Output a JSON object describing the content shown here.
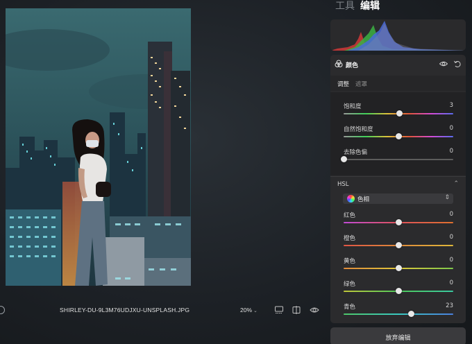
{
  "tabs": [
    {
      "label": "工具",
      "active": false
    },
    {
      "label": "编辑",
      "active": true
    }
  ],
  "photo": {
    "description_icon": "city-night-portrait"
  },
  "bottom_bar": {
    "filename": "SHIRLEY-DU-9L3M76UDJXU-UNSPLASH.JPG",
    "zoom": "20%",
    "icons": [
      "info-icon",
      "filmstrip-icon",
      "compare-icon",
      "eye-icon"
    ]
  },
  "color_panel": {
    "title": "颜色",
    "subtabs": [
      {
        "label": "调整",
        "active": true
      },
      {
        "label": "遮罩",
        "active": false
      }
    ],
    "sliders": [
      {
        "label": "饱和度",
        "value": "3",
        "fraction": 0.51,
        "gradient": "linear-gradient(90deg,#9a9a9a,#3fd15a,#e0c23a,#e2553a,#d64bd6,#5a6cf0)"
      },
      {
        "label": "自然饱和度",
        "value": "0",
        "fraction": 0.5,
        "gradient": "linear-gradient(90deg,#9a9a9a,#3fd15a,#e0c23a,#e2553a,#d64bd6,#5a6cf0)"
      },
      {
        "label": "去除色偏",
        "value": "0",
        "fraction": 0.0,
        "gradient": "linear-gradient(90deg,#5c5c5c,#5c5c5c)"
      }
    ],
    "hsl": {
      "title": "HSL",
      "selector": "色相",
      "sliders": [
        {
          "label": "红色",
          "value": "0",
          "fraction": 0.5,
          "gradient": "linear-gradient(90deg,#c24bd6,#e0535a,#e0702e)"
        },
        {
          "label": "橙色",
          "value": "0",
          "fraction": 0.5,
          "gradient": "linear-gradient(90deg,#e05545,#e08a3a,#e0b83a)"
        },
        {
          "label": "黄色",
          "value": "0",
          "fraction": 0.5,
          "gradient": "linear-gradient(90deg,#e08a3a,#e0c83a,#7ec84a)"
        },
        {
          "label": "绿色",
          "value": "0",
          "fraction": 0.5,
          "gradient": "linear-gradient(90deg,#c0c83a,#4ec85a,#3ac8a0)"
        },
        {
          "label": "青色",
          "value": "23",
          "fraction": 0.615,
          "gradient": "linear-gradient(90deg,#4ec86a,#3ac8c0,#4a80e0)"
        }
      ]
    },
    "discard_label": "放弃编辑"
  },
  "colors": {
    "accent_active_tab": "#ffffff",
    "panel_bg": "#2b2b2d"
  }
}
